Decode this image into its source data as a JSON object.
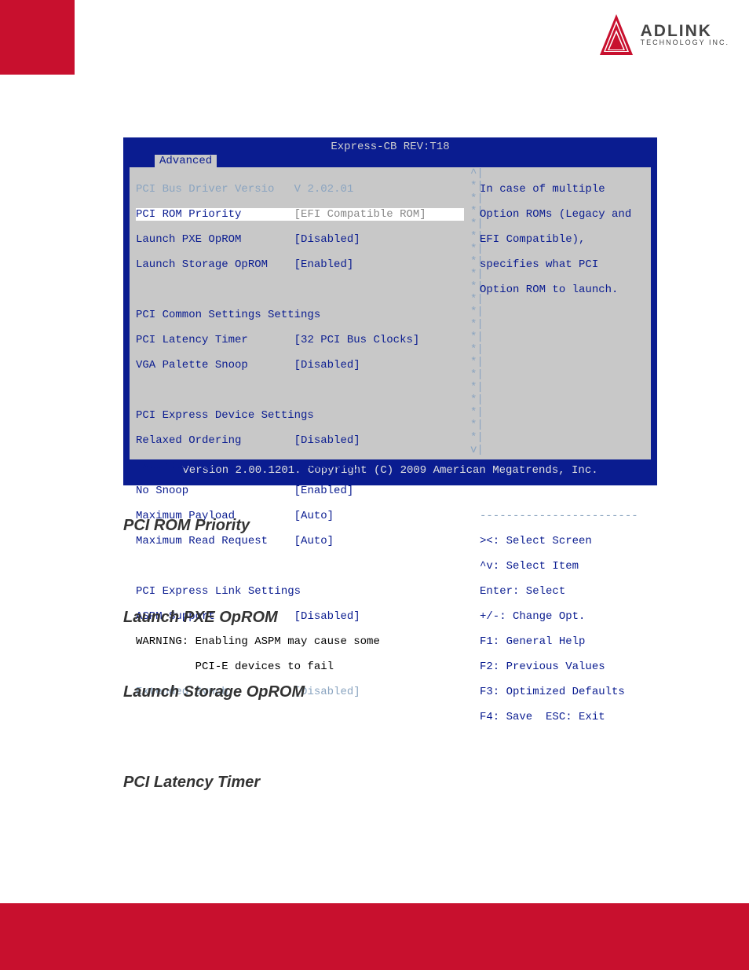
{
  "logo": {
    "name": "ADLINK",
    "sub": "TECHNOLOGY INC."
  },
  "bios": {
    "title": "Express-CB REV:T18",
    "tab": "Advanced",
    "version_row": {
      "label": "PCI Bus Driver Versio",
      "value": "V 2.02.01"
    },
    "selected_row": {
      "label": "PCI ROM Priority",
      "value": "[EFI Compatible ROM]"
    },
    "rows1": [
      {
        "label": "Launch PXE OpROM",
        "value": "[Disabled]"
      },
      {
        "label": "Launch Storage OpROM",
        "value": "[Enabled]"
      }
    ],
    "group1_title": "PCI Common Settings Settings",
    "group1_rows": [
      {
        "label": "PCI Latency Timer",
        "value": "[32 PCI Bus Clocks]"
      },
      {
        "label": "VGA Palette Snoop",
        "value": "[Disabled]"
      }
    ],
    "group2_title": "PCI Express Device Settings",
    "group2_rows": [
      {
        "label": "Relaxed Ordering",
        "value": "[Disabled]"
      },
      {
        "label": "Extended Tag",
        "value": "[Disabled]"
      },
      {
        "label": "No Snoop",
        "value": "[Enabled]"
      },
      {
        "label": "Maximum Payload",
        "value": "[Auto]"
      },
      {
        "label": "Maximum Read Request",
        "value": "[Auto]"
      }
    ],
    "group3_title": "PCI Express Link Settings",
    "group3_rows": [
      {
        "label": "ASPM Support",
        "value": "[Disabled]"
      }
    ],
    "warn1": "WARNING: Enabling ASPM may cause some",
    "warn2": "         PCI-E devices to fail",
    "ext_row": {
      "label": "Extended Synch",
      "value": "[Disabled]"
    },
    "help": {
      "l1": "In case of multiple",
      "l2": "Option ROMs (Legacy and",
      "l3": "EFI Compatible),",
      "l4": "specifies what PCI",
      "l5": "Option ROM to launch."
    },
    "keys": {
      "k1": "><: Select Screen",
      "k2": "^v: Select Item",
      "k3": "Enter: Select",
      "k4": "+/-: Change Opt.",
      "k5": "F1: General Help",
      "k6": "F2: Previous Values",
      "k7": "F3: Optimized Defaults",
      "k8": "F4: Save  ESC: Exit"
    },
    "footer": "Version 2.00.1201. Copyright (C) 2009 American Megatrends, Inc."
  },
  "doc": {
    "h1": "PCI ROM Priority",
    "h2": "Launch PXE OpROM",
    "h3": "Launch Storage OpROM",
    "h4": "PCI Latency Timer"
  }
}
